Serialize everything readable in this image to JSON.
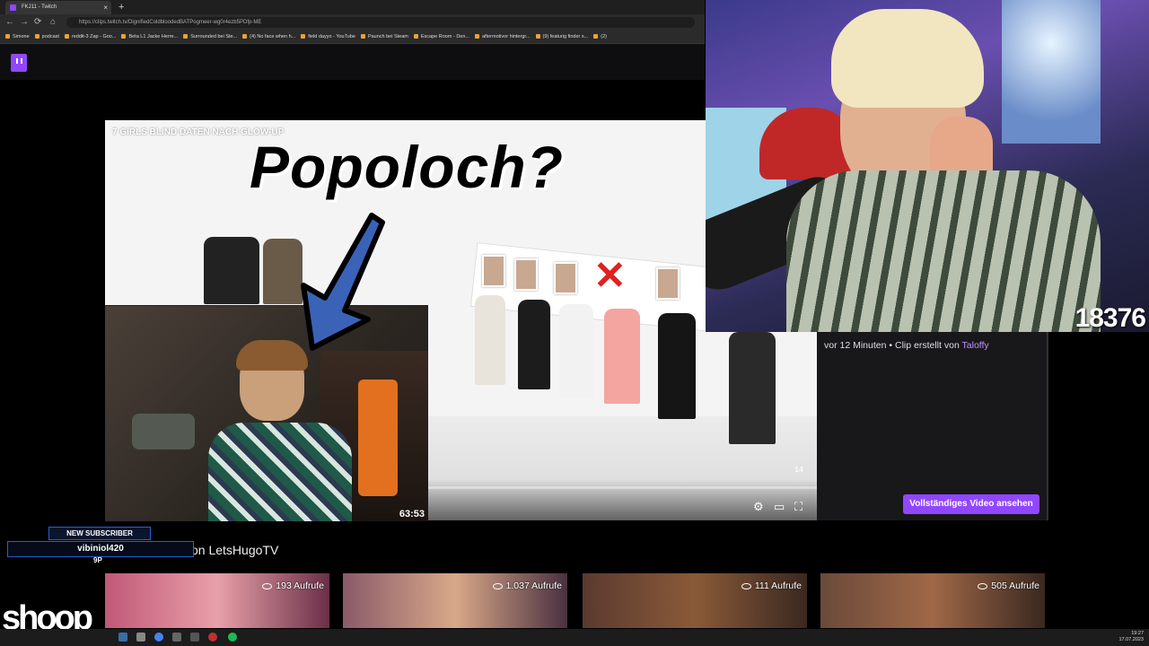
{
  "browser": {
    "tab_title": "FKJ11 - Twitch",
    "new_tab": "+",
    "close": "×",
    "nav": {
      "back": "←",
      "forward": "→",
      "reload": "⟳",
      "home": "⌂"
    },
    "url": "https://clips.twitch.tv/DignifiedColdbloodedBATPogmeer-wg0r4ezb5PDfp-ME",
    "bookmarks": [
      "Simone",
      "podcast",
      "reddit-3 Zap - Goo...",
      "Beta L1 Jacke Herre...",
      "Surrounded bei Ste...",
      "(4) No face when h...",
      "field dayyo - YouTube",
      "Paunch bei Steam",
      "Escape Room - Den...",
      "aftermotivor hintergr...",
      "(9) featurig finder s...",
      "(2)"
    ]
  },
  "video": {
    "title": "7 GIRLS BLIND DATEN NACH GLOW-UP",
    "frame_badge": "14",
    "controls": {
      "settings": "⚙",
      "cast": "▭",
      "fullscreen": "⛶"
    }
  },
  "overlay": {
    "caption": "Popoloch?",
    "arrow_color": "#3a63b8"
  },
  "facecam_left": {
    "timer": "63:53"
  },
  "streamer": {
    "viewer_count": "18376"
  },
  "clip_info": {
    "time_ago": "vor 12 Minuten",
    "separator": "•",
    "created_by": "Clip erstellt von",
    "author": "Taloffy",
    "full_video_button": "Vollständiges Video ansehen"
  },
  "more_clips": {
    "title": "on LetsHugoTV",
    "items": [
      {
        "views": "193 Aufrufe"
      },
      {
        "views": "1.037 Aufrufe"
      },
      {
        "views": "111 Aufrufe"
      },
      {
        "views": "505 Aufrufe"
      }
    ]
  },
  "sub_alert": {
    "header": "NEW SUBSCRIBER",
    "name": "vibiniol420",
    "tier": "9P"
  },
  "watermark": "shoop",
  "taskbar": {
    "time": "19:27",
    "date": "17.07.2023"
  },
  "colors": {
    "twitch_purple": "#9147ff",
    "author_link": "#bf94ff",
    "panel_bg": "#18181b"
  }
}
